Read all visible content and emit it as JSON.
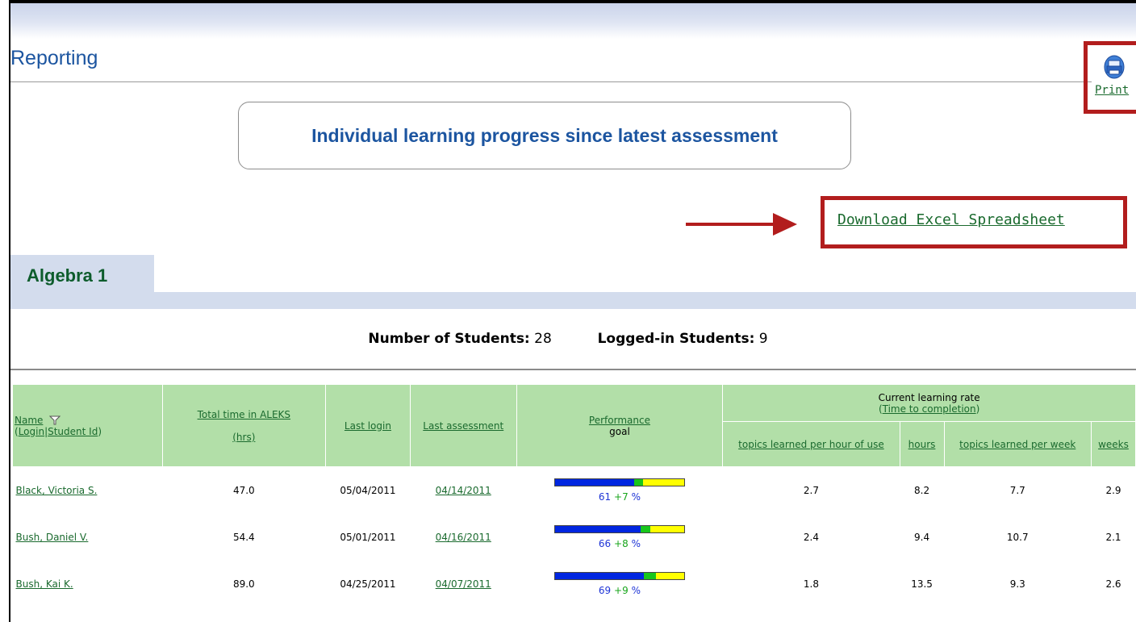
{
  "page": {
    "title": "Reporting",
    "print_label": "Print",
    "heading": "Individual learning progress since latest assessment",
    "excel_link": "Download Excel Spreadsheet"
  },
  "tab": {
    "label": "Algebra 1"
  },
  "stats": {
    "students_label": "Number of Students:",
    "students_value": "28",
    "logged_label": "Logged-in Students:",
    "logged_value": "9"
  },
  "table": {
    "headers": {
      "name": "Name",
      "login": "Login",
      "student_id": "Student Id",
      "total_time": "Total time in ALEKS",
      "total_time_unit": "(hrs)",
      "last_login": "Last login",
      "last_assessment": "Last assessment",
      "performance": "Performance",
      "goal": "goal",
      "learning_rate": "Current learning rate",
      "time_to_completion": "Time to completion",
      "topics_per_hour": "topics learned per hour of use",
      "hours": "hours",
      "topics_per_week": "topics learned per week",
      "weeks": "weeks"
    },
    "rows": [
      {
        "name": "Black, Victoria S.",
        "total_time": "47.0",
        "last_login": "05/04/2011",
        "last_assessment": "04/14/2011",
        "perf_base": "61",
        "perf_gain": "+7",
        "perf_unit": "%",
        "perf_fraction": 0.61,
        "gain_fraction": 0.07,
        "topics_per_hour": "2.7",
        "hours": "8.2",
        "topics_per_week": "7.7",
        "weeks": "2.9"
      },
      {
        "name": "Bush, Daniel V.",
        "total_time": "54.4",
        "last_login": "05/01/2011",
        "last_assessment": "04/16/2011",
        "perf_base": "66",
        "perf_gain": "+8",
        "perf_unit": "%",
        "perf_fraction": 0.66,
        "gain_fraction": 0.08,
        "topics_per_hour": "2.4",
        "hours": "9.4",
        "topics_per_week": "10.7",
        "weeks": "2.1"
      },
      {
        "name": "Bush, Kai K.",
        "total_time": "89.0",
        "last_login": "04/25/2011",
        "last_assessment": "04/07/2011",
        "perf_base": "69",
        "perf_gain": "+9",
        "perf_unit": "%",
        "perf_fraction": 0.69,
        "gain_fraction": 0.09,
        "topics_per_hour": "1.8",
        "hours": "13.5",
        "topics_per_week": "9.3",
        "weeks": "2.6"
      }
    ]
  },
  "colors": {
    "title_blue": "#1c55a0",
    "link_green": "#1a6a2e",
    "header_green": "#b2dfa8",
    "highlight_red": "#b21d1d",
    "bar_blue": "#0026e0",
    "bar_green": "#18c61b",
    "bar_yellow": "#ffff00"
  },
  "icons": {
    "print": "printer-icon",
    "filter": "funnel-icon",
    "arrow": "arrow-right-icon"
  }
}
